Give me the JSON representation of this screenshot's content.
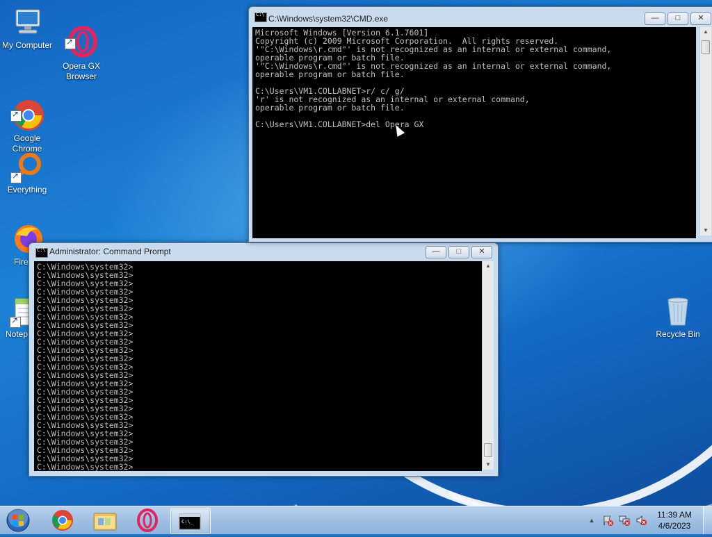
{
  "desktop": {
    "icons": [
      {
        "label": "My Computer",
        "icon": "computer-icon"
      },
      {
        "label": "Opera GX\nBrowser",
        "icon": "opera-gx-icon"
      },
      {
        "label": "Google\nChrome",
        "icon": "chrome-icon"
      },
      {
        "label": "Everything",
        "icon": "everything-icon"
      },
      {
        "label": "Fire",
        "icon": "firefox-icon"
      },
      {
        "label": "Notep",
        "icon": "notepad-icon"
      },
      {
        "label": "Recycle Bin",
        "icon": "recycle-bin-icon"
      }
    ]
  },
  "cmd_window": {
    "title": "C:\\Windows\\system32\\CMD.exe",
    "lines": [
      "Microsoft Windows [Version 6.1.7601]",
      "Copyright (c) 2009 Microsoft Corporation.  All rights reserved.",
      "'\"C:\\Windows\\r.cmd\"' is not recognized as an internal or external command,",
      "operable program or batch file.",
      "'\"C:\\Windows\\r.cmd\"' is not recognized as an internal or external command,",
      "operable program or batch file.",
      "",
      "C:\\Users\\VM1.COLLABNET>r/ c/ g/",
      "'r' is not recognized as an internal or external command,",
      "operable program or batch file.",
      "",
      "C:\\Users\\VM1.COLLABNET>del Opera GX"
    ]
  },
  "admin_window": {
    "title": "Administrator:  Command Prompt",
    "lines": [
      "C:\\Windows\\system32>",
      "C:\\Windows\\system32>",
      "C:\\Windows\\system32>",
      "C:\\Windows\\system32>",
      "C:\\Windows\\system32>",
      "C:\\Windows\\system32>",
      "C:\\Windows\\system32>",
      "C:\\Windows\\system32>",
      "C:\\Windows\\system32>",
      "C:\\Windows\\system32>",
      "C:\\Windows\\system32>",
      "C:\\Windows\\system32>",
      "C:\\Windows\\system32>",
      "C:\\Windows\\system32>",
      "C:\\Windows\\system32>",
      "C:\\Windows\\system32>",
      "C:\\Windows\\system32>",
      "C:\\Windows\\system32>",
      "C:\\Windows\\system32>",
      "C:\\Windows\\system32>",
      "C:\\Windows\\system32>",
      "C:\\Windows\\system32>",
      "C:\\Windows\\system32>",
      "C:\\Windows\\system32>",
      "C:\\Windows\\system32>"
    ]
  },
  "window_controls": {
    "minimize": "—",
    "maximize": "□",
    "close": "✕"
  },
  "taskbar": {
    "buttons": [
      {
        "icon": "start-orb-icon"
      },
      {
        "icon": "chrome-icon"
      },
      {
        "icon": "file-explorer-icon"
      },
      {
        "icon": "opera-gx-icon"
      },
      {
        "icon": "cmd-icon"
      }
    ],
    "tray": {
      "show_hidden": "▲",
      "clock_time": "11:39 AM",
      "clock_date": "4/6/2023"
    }
  }
}
